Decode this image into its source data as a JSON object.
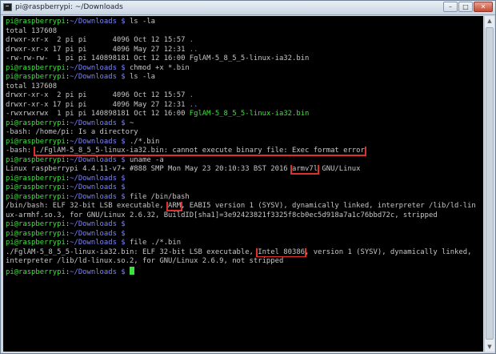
{
  "window": {
    "title": "pi@raspberrypi: ~/Downloads",
    "minimize": "–",
    "maximize": "□",
    "close": "✕"
  },
  "scrollbar": {
    "up": "▲",
    "down": "▼"
  },
  "prompt": {
    "user": "pi@raspberrypi",
    "sep": ":",
    "path": "~/Downloads $ "
  },
  "terminal": {
    "cmd_ls1": "ls -la",
    "ls1_total": "total 137608",
    "ls1_r1_pre": "drwxr-xr-x  2 pi pi      4096 Oct 12 15:57 ",
    "ls1_r1_name": ".",
    "ls1_r2_pre": "drwxr-xr-x 17 pi pi      4096 May 27 12:31 ",
    "ls1_r2_name": "..",
    "ls1_r3": "-rw-rw-rw-  1 pi pi 140898181 Oct 12 16:00 FglAM-5_8_5_5-linux-ia32.bin",
    "cmd_chmod": "chmod +x *.bin",
    "cmd_ls2": "ls -la",
    "ls2_total": "total 137608",
    "ls2_r1_pre": "drwxr-xr-x  2 pi pi      4096 Oct 12 15:57 ",
    "ls2_r1_name": ".",
    "ls2_r2_pre": "drwxr-xr-x 17 pi pi      4096 May 27 12:31 ",
    "ls2_r2_name": "..",
    "ls2_r3_pre": "-rwxrwxrwx  1 pi pi 140898181 Oct 12 16:00 ",
    "ls2_r3_name": "FglAM-5_8_5_5-linux-ia32.bin",
    "cmd_tilde": "~",
    "err_dir": "-bash: /home/pi: Is a directory",
    "cmd_run": "./*.bin",
    "err_exec_pre": "-bash: ",
    "err_exec_msg": "./FglAM-5_8_5_5-linux-ia32.bin: cannot execute binary file: Exec format error",
    "cmd_uname": "uname -a",
    "uname_pre": "Linux raspberrypi 4.4.11-v7+ #888 SMP Mon May 23 20:10:33 BST 2016 ",
    "uname_arch": "armv7l",
    "uname_post": " GNU/Linux",
    "cmd_file_bash": "file /bin/bash",
    "file_bash_pre": "/bin/bash: ELF 32-bit LSB executable, ",
    "file_bash_arch": "ARM",
    "file_bash_post": ", EABI5 version 1 (SYSV), dynamically linked, interpreter /lib/ld-lin",
    "file_bash_l2": "ux-armhf.so.3, for GNU/Linux 2.6.32, BuildID[sha1]=3e92423821f3325f8cb0ec5d918a7a1c76bbd72c, stripped",
    "cmd_file_bin": "file ./*.bin",
    "file_bin_pre": "./FglAM-5_8_5_5-linux-ia32.bin: ELF 32-bit LSB executable, ",
    "file_bin_arch": "Intel 80386",
    "file_bin_post": ", version 1 (SYSV), dynamically linked,",
    "file_bin_l2": "interpreter /lib/ld-linux.so.2, for GNU/Linux 2.6.9, not stripped"
  }
}
